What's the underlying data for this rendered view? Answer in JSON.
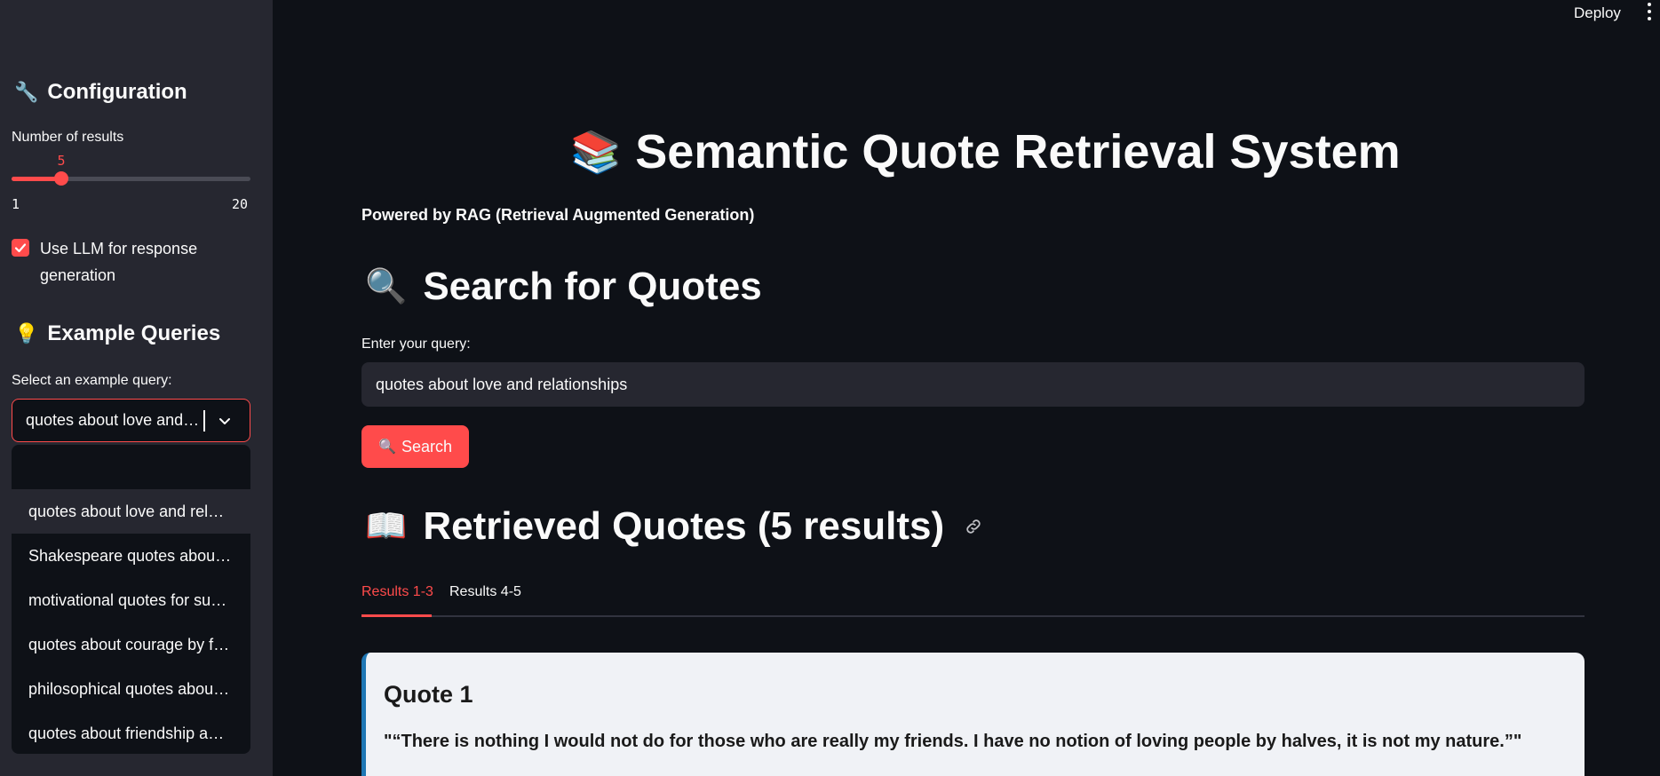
{
  "header": {
    "deploy_label": "Deploy",
    "menu_icon": "kebab-menu-icon"
  },
  "sidebar": {
    "config_icon": "🔧",
    "config_heading": "Configuration",
    "results_label": "Number of results",
    "slider": {
      "value": "5",
      "min": "1",
      "max": "20",
      "fraction": 0.21
    },
    "use_llm_label": "Use LLM for response generation",
    "use_llm_checked": true,
    "examples_icon": "💡",
    "examples_heading": "Example Queries",
    "select_label": "Select an example query:",
    "select_value": "quotes about love and relationships",
    "options": [
      "",
      "quotes about love and relationships",
      "Shakespeare quotes about life",
      "motivational quotes for success",
      "quotes about courage by famous authors",
      "philosophical quotes about life",
      "quotes about friendship and loyalty"
    ]
  },
  "main": {
    "title_icon": "📚",
    "title": "Semantic Quote Retrieval System",
    "subtitle": "Powered by RAG (Retrieval Augmented Generation)",
    "search_icon": "🔍",
    "search_heading": "Search for Quotes",
    "query_label": "Enter your query:",
    "query_value": "quotes about love and relationships",
    "search_button_icon": "🔍",
    "search_button": "Search",
    "results_icon": "📖",
    "results_heading": "Retrieved Quotes (5 results)",
    "tabs": [
      "Results 1-3",
      "Results 4-5"
    ],
    "active_tab": 0,
    "quote_heading": "Quote 1",
    "quote_text": "\"“There is nothing I would not do for those who are really my friends. I have no notion of loving people by halves, it is not my nature.”\""
  },
  "colors": {
    "accent": "#ff4b4b",
    "sidebar_bg": "#262730",
    "main_bg": "#0e1117",
    "card_bg": "#f0f2f6",
    "card_border": "#1f77b4"
  }
}
